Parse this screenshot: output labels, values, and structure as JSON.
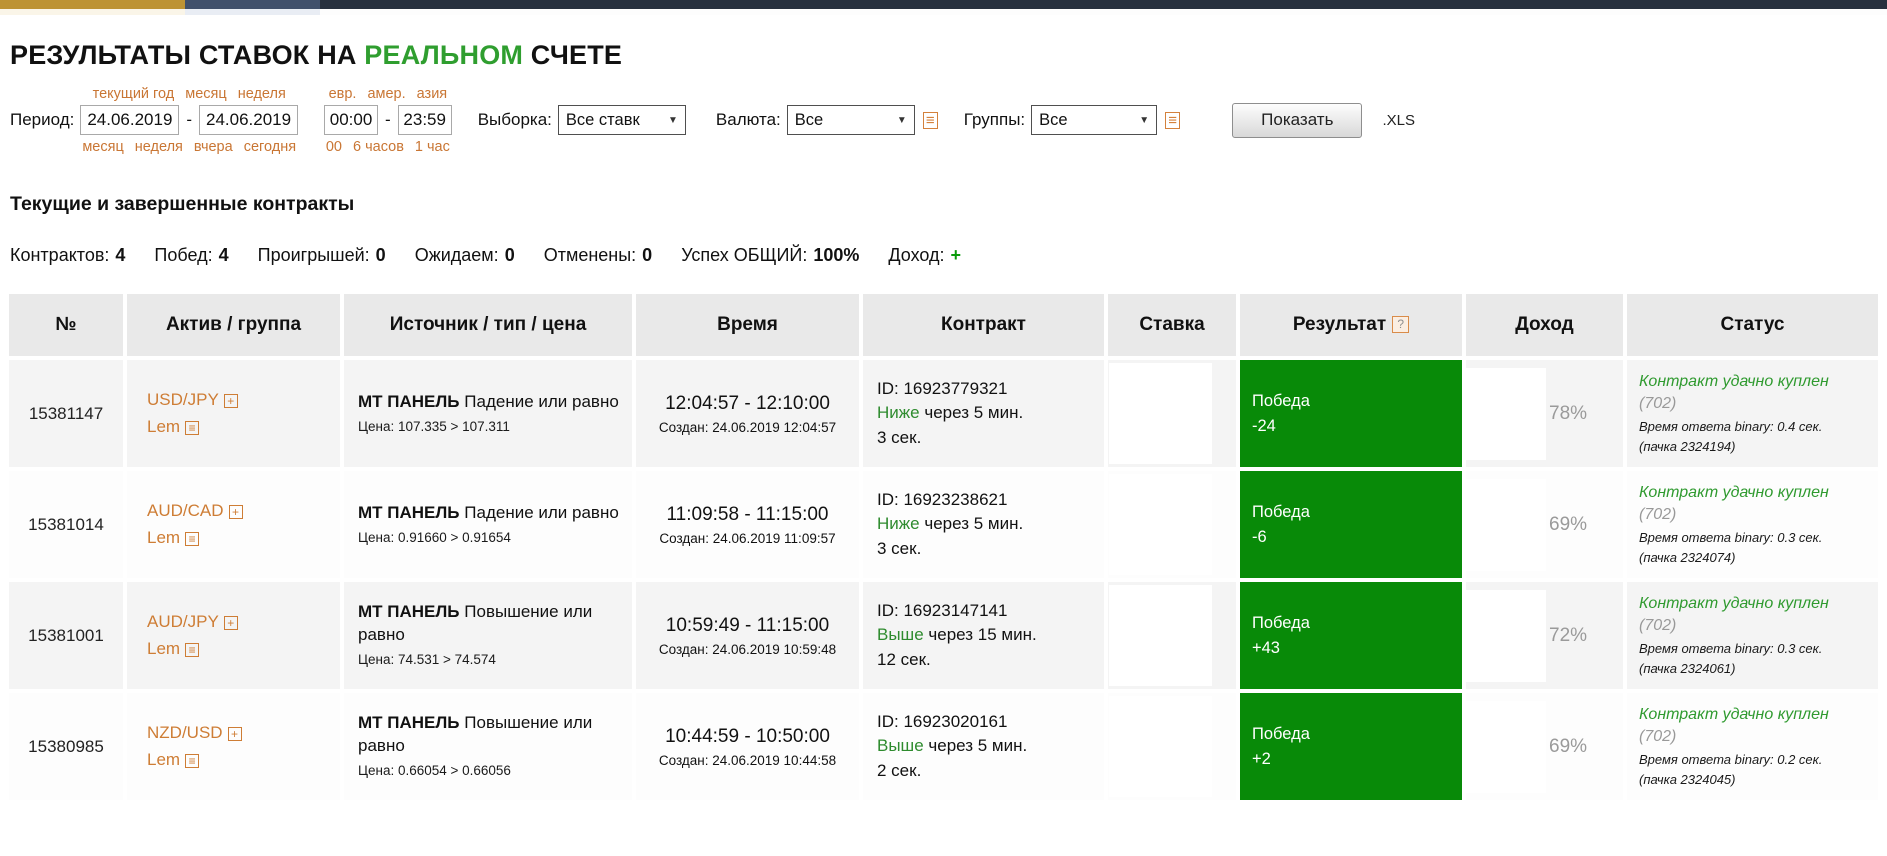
{
  "colors": {
    "accent_orange": "#ce7d35",
    "title_green": "#2f9e2f",
    "result_green": "#088a08",
    "status_green": "#2f9a2f"
  },
  "icons": {
    "plus": "+",
    "list": "≡",
    "select_arrow": "▼",
    "help": "?"
  },
  "title": {
    "pre": "РЕЗУЛЬТАТЫ СТАВОК НА",
    "highlight": "РЕАЛЬНОМ",
    "post": "СЧЕТЕ"
  },
  "filters": {
    "period_label": "Период:",
    "date_from": "24.06.2019",
    "date_to": "24.06.2019",
    "date_links_top": [
      "текущий год",
      "месяц",
      "неделя"
    ],
    "date_links_bottom": [
      "месяц",
      "неделя",
      "вчера",
      "сегодня"
    ],
    "time_from": "00:00",
    "time_to": "23:59",
    "time_links_top": [
      "евр.",
      "амер.",
      "азия"
    ],
    "time_links_bottom": [
      "00",
      "6 часов",
      "1 час"
    ],
    "sample_label": "Выборка:",
    "sample_value": "Все ставк",
    "currency_label": "Валюта:",
    "currency_value": "Все",
    "groups_label": "Группы:",
    "groups_value": "Все",
    "show_button": "Показать",
    "xls_label": ".XLS"
  },
  "section_title": "Текущие и завершенные контракты",
  "stats": {
    "contracts_label": "Контрактов:",
    "contracts": "4",
    "wins_label": "Побед:",
    "wins": "4",
    "losses_label": "Проигрышей:",
    "losses": "0",
    "pending_label": "Ожидаем:",
    "pending": "0",
    "cancelled_label": "Отменены:",
    "cancelled": "0",
    "success_label": "Успех ОБЩИЙ:",
    "success": "100%",
    "income_label": "Доход:",
    "income_sign": "+"
  },
  "table": {
    "headers": {
      "num": "№",
      "asset": "Актив / группа",
      "source": "Источник / тип / цена",
      "time": "Время",
      "contract": "Контракт",
      "stake": "Ставка",
      "result": "Результат",
      "income": "Доход",
      "status": "Статус"
    },
    "rows": [
      {
        "num": "15381147",
        "asset": "USD/JPY",
        "group": "Lem",
        "source": "МТ ПАНЕЛЬ",
        "type": "Падение или равно",
        "price": "Цена: 107.335 > 107.311",
        "time": "12:04:57 - 12:10:00",
        "created": "Создан: 24.06.2019 12:04:57",
        "contract_id": "ID: 16923779321",
        "direction": "Ниже",
        "duration": "через 5 мин.",
        "duration2": "3 сек.",
        "result_label": "Победа",
        "result_value": "-24",
        "income": "78%",
        "status_link": "Контракт удачно куплен",
        "status_code": "(702)",
        "status_time": "Время ответа binary: 0.4 сек.",
        "status_batch": "(пачка 2324194)"
      },
      {
        "num": "15381014",
        "asset": "AUD/CAD",
        "group": "Lem",
        "source": "МТ ПАНЕЛЬ",
        "type": "Падение или равно",
        "price": "Цена: 0.91660 > 0.91654",
        "time": "11:09:58 - 11:15:00",
        "created": "Создан: 24.06.2019 11:09:57",
        "contract_id": "ID: 16923238621",
        "direction": "Ниже",
        "duration": "через 5 мин.",
        "duration2": "3 сек.",
        "result_label": "Победа",
        "result_value": "-6",
        "income": "69%",
        "status_link": "Контракт удачно куплен",
        "status_code": "(702)",
        "status_time": "Время ответа binary: 0.3 сек.",
        "status_batch": "(пачка 2324074)"
      },
      {
        "num": "15381001",
        "asset": "AUD/JPY",
        "group": "Lem",
        "source": "МТ ПАНЕЛЬ",
        "type": "Повышение или равно",
        "price": "Цена: 74.531 > 74.574",
        "time": "10:59:49 - 11:15:00",
        "created": "Создан: 24.06.2019 10:59:48",
        "contract_id": "ID: 16923147141",
        "direction": "Выше",
        "duration": "через 15 мин.",
        "duration2": "12 сек.",
        "result_label": "Победа",
        "result_value": "+43",
        "income": "72%",
        "status_link": "Контракт удачно куплен",
        "status_code": "(702)",
        "status_time": "Время ответа binary: 0.3 сек.",
        "status_batch": "(пачка 2324061)"
      },
      {
        "num": "15380985",
        "asset": "NZD/USD",
        "group": "Lem",
        "source": "МТ ПАНЕЛЬ",
        "type": "Повышение или равно",
        "price": "Цена: 0.66054 > 0.66056",
        "time": "10:44:59 - 10:50:00",
        "created": "Создан: 24.06.2019 10:44:58",
        "contract_id": "ID: 16923020161",
        "direction": "Выше",
        "duration": "через 5 мин.",
        "duration2": "2 сек.",
        "result_label": "Победа",
        "result_value": "+2",
        "income": "69%",
        "status_link": "Контракт удачно куплен",
        "status_code": "(702)",
        "status_time": "Время ответа binary: 0.2 сек.",
        "status_batch": "(пачка 2324045)"
      }
    ]
  }
}
